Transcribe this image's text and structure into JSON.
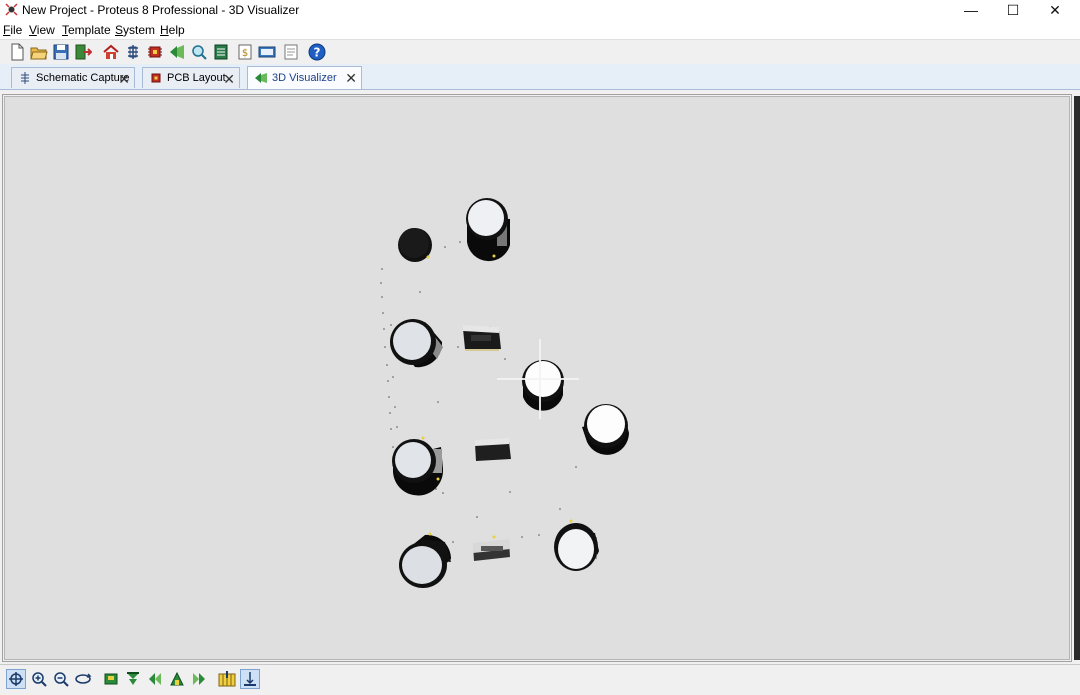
{
  "window": {
    "title": "New Project - Proteus 8 Professional - 3D Visualizer",
    "controls": [
      "—",
      "☐",
      "✕"
    ]
  },
  "menu": [
    {
      "label": "File",
      "key": "F"
    },
    {
      "label": "View",
      "key": "V"
    },
    {
      "label": "Template",
      "key": "T"
    },
    {
      "label": "System",
      "key": "S"
    },
    {
      "label": "Help",
      "key": "H"
    }
  ],
  "toolbar": {
    "icons": [
      "new-file-icon",
      "open-folder-icon",
      "save-icon",
      "close-project-icon",
      "home-icon",
      "schematic-icon",
      "pcb-icon",
      "3d-visualizer-icon",
      "gerber-viewer-icon",
      "bom-icon",
      "design-explorer-icon",
      "vsm-studio-icon",
      "notes-icon",
      "help-icon"
    ]
  },
  "tabs": [
    {
      "label": "Schematic Capture",
      "icon": "schematic-icon",
      "active": false
    },
    {
      "label": "PCB Layout",
      "icon": "pcb-icon",
      "active": false
    },
    {
      "label": "3D Visualizer",
      "icon": "3d-visualizer-icon",
      "active": true
    }
  ],
  "bottom_toolbar": {
    "icons": [
      "pan-icon",
      "zoom-in-icon",
      "zoom-out-icon",
      "orbit-icon",
      "top-view-icon",
      "front-view-icon",
      "left-view-icon",
      "back-view-icon",
      "right-view-icon",
      "height-toggle-icon",
      "board-toggle-icon"
    ]
  },
  "colors": {
    "viewport_bg": "#dfdfdf",
    "active_tab_text": "#1a3f8a",
    "help_blue": "#1f5fc4"
  }
}
